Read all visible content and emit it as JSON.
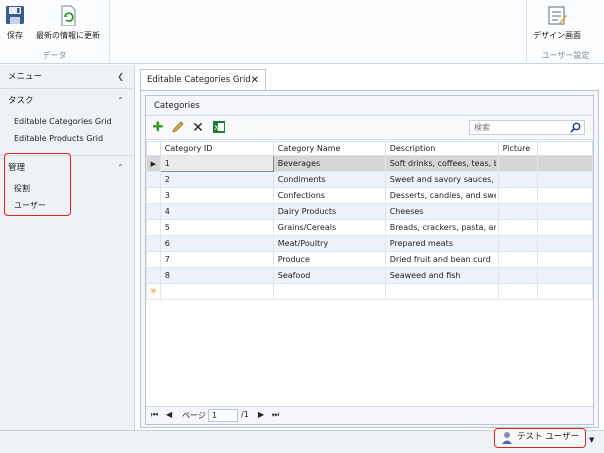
{
  "ribbon": {
    "data_group": {
      "label": "データ",
      "save": "保存",
      "refresh": "最新の情報に更新"
    },
    "user_group": {
      "label": "ユーザー設定",
      "design": "デザイン画面"
    }
  },
  "left_panel": {
    "menu_title": "メニュー",
    "tasks": {
      "title": "タスク",
      "items": [
        "Editable Categories Grid",
        "Editable Products Grid"
      ]
    },
    "admin": {
      "title": "管理",
      "items": [
        "役割",
        "ユーザー"
      ]
    }
  },
  "tab": {
    "label": "Editable Categories Grid"
  },
  "grid": {
    "title": "Categories",
    "search_placeholder": "検索",
    "columns": [
      "Category ID",
      "Category Name",
      "Description",
      "Picture"
    ],
    "rows": [
      {
        "id": "1",
        "name": "Beverages",
        "desc": "Soft drinks, coffees, teas, beer"
      },
      {
        "id": "2",
        "name": "Condiments",
        "desc": "Sweet and savory sauces, relis"
      },
      {
        "id": "3",
        "name": "Confections",
        "desc": "Desserts, candies, and sweet b"
      },
      {
        "id": "4",
        "name": "Dairy Products",
        "desc": "Cheeses"
      },
      {
        "id": "5",
        "name": "Grains/Cereals",
        "desc": "Breads, crackers, pasta, and ce"
      },
      {
        "id": "6",
        "name": "Meat/Poultry",
        "desc": "Prepared meats"
      },
      {
        "id": "7",
        "name": "Produce",
        "desc": "Dried fruit and bean curd"
      },
      {
        "id": "8",
        "name": "Seafood",
        "desc": "Seaweed and fish"
      }
    ],
    "selected_row": 0
  },
  "pager": {
    "page_label": "ページ",
    "page_value": "1",
    "page_total": "/1"
  },
  "status": {
    "user": "テスト ユーザー"
  },
  "colors": {
    "highlight": "#e0231c",
    "grid_alt_row": "#eef3fa",
    "selected_row": "#d6d6d6",
    "add_icon": "#3a9a2e",
    "excel_icon": "#1f7a3a"
  },
  "icons": {
    "save": "floppy-disk-icon",
    "refresh": "refresh-document-icon",
    "design": "design-screen-icon",
    "add": "plus-icon",
    "edit": "pencil-icon",
    "delete": "x-delete-icon",
    "export": "excel-export-icon",
    "search": "magnifier-icon",
    "user": "user-icon"
  }
}
